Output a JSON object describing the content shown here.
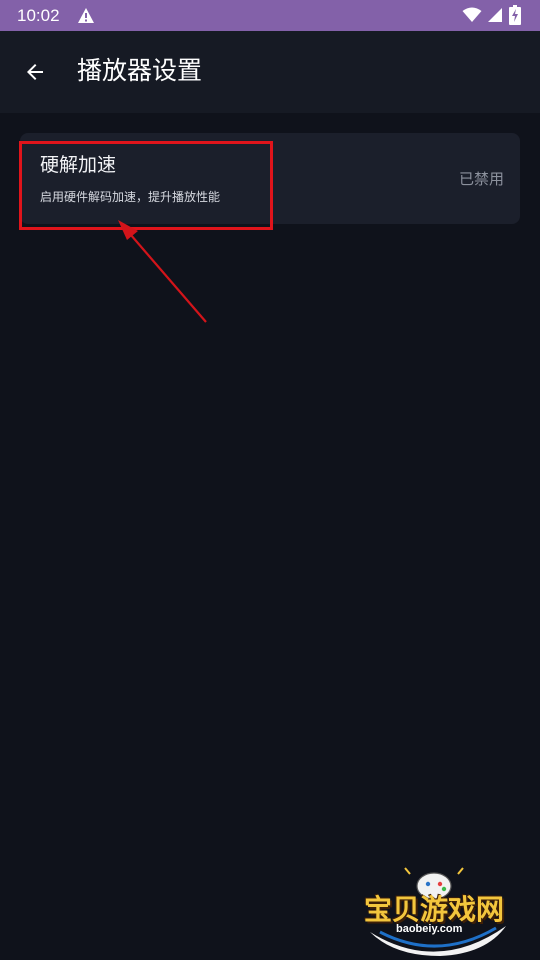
{
  "status_bar": {
    "time": "10:02",
    "background": "#8361a9"
  },
  "app_bar": {
    "title": "播放器设置",
    "back_icon": "arrow-left-icon"
  },
  "settings": {
    "items": [
      {
        "title": "硬解加速",
        "description": "启用硬件解码加速，提升播放性能",
        "status": "已禁用"
      }
    ]
  },
  "annotation": {
    "color": "#e0141b"
  },
  "watermark": {
    "text": "宝贝游戏网",
    "url": "baobeiy.com"
  }
}
